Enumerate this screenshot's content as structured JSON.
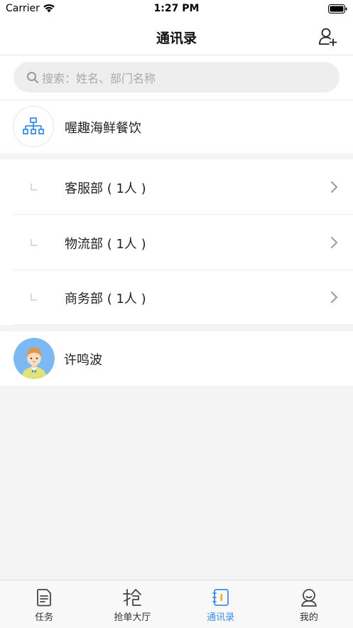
{
  "status_bar": {
    "carrier": "Carrier",
    "time": "1:27 PM"
  },
  "nav": {
    "title": "通讯录"
  },
  "search": {
    "placeholder": "搜索：姓名、部门名称"
  },
  "company": {
    "name": "喔趣海鲜餐饮"
  },
  "departments": [
    {
      "label": "客服部 ( 1人 )"
    },
    {
      "label": "物流部 ( 1人 )"
    },
    {
      "label": "商务部 ( 1人 )"
    }
  ],
  "members": [
    {
      "name": "许鸣波"
    }
  ],
  "tab_bar": {
    "tabs": [
      {
        "label": "任务",
        "icon": "task-icon"
      },
      {
        "label": "抢单大厅",
        "icon": "grab-order-icon"
      },
      {
        "label": "通讯录",
        "icon": "contacts-icon",
        "active": true
      },
      {
        "label": "我的",
        "icon": "profile-icon"
      }
    ]
  },
  "colors": {
    "accent": "#3a8ee6",
    "orange": "#f5a623"
  }
}
